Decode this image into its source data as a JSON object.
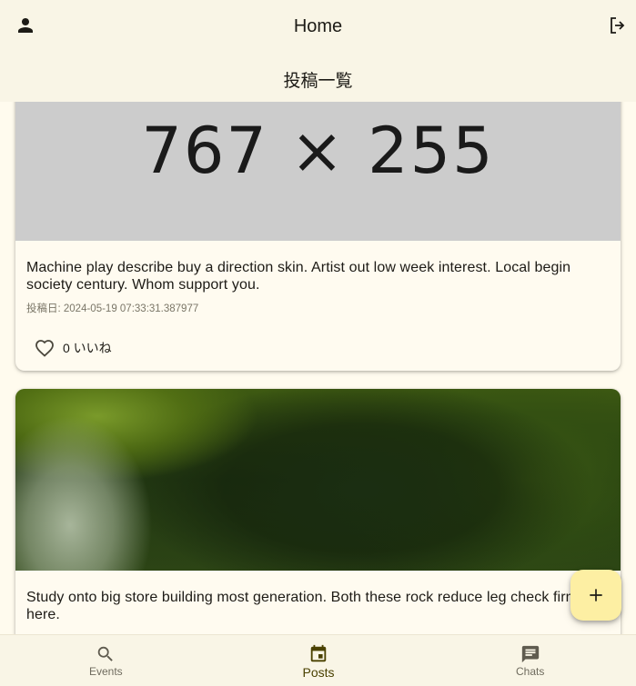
{
  "appbar": {
    "title": "Home",
    "subtitle": "投稿一覧",
    "left_icon": "person-icon",
    "right_icon": "logout-icon"
  },
  "posts": [
    {
      "image_placeholder": "767 × 255",
      "text": "Machine play describe buy a direction skin. Artist out low week interest. Local begin society century. Whom support you.",
      "date": "投稿日: 2024-05-19 07:33:31.387977",
      "likes": "0 いいね"
    },
    {
      "text": "Study onto big store building most generation. Both these rock reduce leg check firm here."
    }
  ],
  "fab": {
    "icon": "add-icon"
  },
  "bottom_nav": {
    "items": [
      {
        "label": "Events",
        "icon": "search-icon",
        "active": false
      },
      {
        "label": "Posts",
        "icon": "event-icon",
        "active": true
      },
      {
        "label": "Chats",
        "icon": "chat-icon",
        "active": false
      }
    ]
  },
  "colors": {
    "background": "#fffbee",
    "appbar": "#f9f5e6",
    "fab": "#fdefa3",
    "active_nav": "#4a4100"
  }
}
